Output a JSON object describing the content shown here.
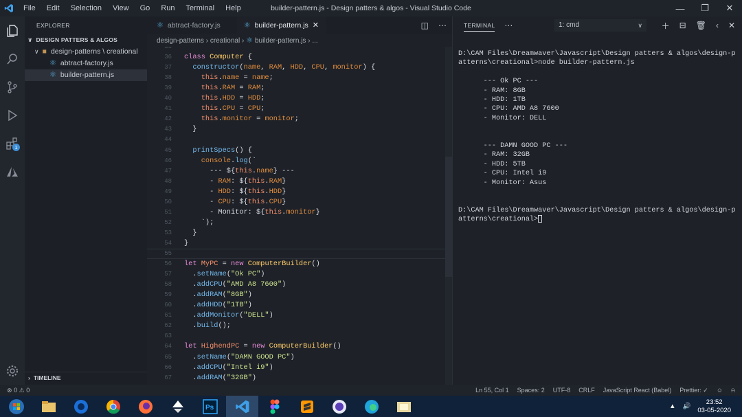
{
  "window": {
    "title": "builder-pattern.js - Design patters & algos - Visual Studio Code",
    "menu": [
      "File",
      "Edit",
      "Selection",
      "View",
      "Go",
      "Run",
      "Terminal",
      "Help"
    ],
    "controls": [
      "minimize",
      "maximize",
      "close"
    ]
  },
  "sidebar": {
    "header": "EXPLORER",
    "section": "DESIGN PATTERS & ALGOS",
    "folder": "design-patterns \\ creational",
    "files": [
      "abtract-factory.js",
      "builder-pattern.js"
    ],
    "timeline": "TIMELINE"
  },
  "activity": {
    "badge": "1"
  },
  "tabs": [
    {
      "label": "abtract-factory.js",
      "active": false
    },
    {
      "label": "builder-pattern.js",
      "active": true
    }
  ],
  "breadcrumb": {
    "parts": [
      "design-patterns",
      "creational",
      "builder-pattern.js",
      "..."
    ]
  },
  "code": {
    "first_line": 35,
    "lines": [
      "",
      "class Computer {",
      "  constructor(name, RAM, HDD, CPU, monitor) {",
      "    this.name = name;",
      "    this.RAM = RAM;",
      "    this.HDD = HDD;",
      "    this.CPU = CPU;",
      "    this.monitor = monitor;",
      "  }",
      "",
      "  printSpecs() {",
      "    console.log(`",
      "      --- ${this.name} ---",
      "      - RAM: ${this.RAM}",
      "      - HDD: ${this.HDD}",
      "      - CPU: ${this.CPU}",
      "      - Monitor: ${this.monitor}",
      "    `);",
      "  }",
      "}",
      "",
      "let MyPC = new ComputerBuilder()",
      "  .setName(\"Ok PC\")",
      "  .addCPU(\"AMD A8 7600\")",
      "  .addRAM(\"8GB\")",
      "  .addHDD(\"1TB\")",
      "  .addMonitor(\"DELL\")",
      "  .build();",
      "",
      "let HighendPC = new ComputerBuilder()",
      "  .setName(\"DAMN GOOD PC\")",
      "  .addCPU(\"Intel i9\")",
      "  .addRAM(\"32GB\")"
    ]
  },
  "panel": {
    "title": "TERMINAL",
    "shell": "1: cmd"
  },
  "terminal": {
    "lines": [
      "D:\\CAM Files\\Dreamwaver\\Javascript\\Design patters & algos\\design-p",
      "atterns\\creational>node builder-pattern.js",
      "",
      "      --- Ok PC ---",
      "      - RAM: 8GB",
      "      - HDD: 1TB",
      "      - CPU: AMD A8 7600",
      "      - Monitor: DELL",
      "",
      "",
      "      --- DAMN GOOD PC ---",
      "      - RAM: 32GB",
      "      - HDD: 5TB",
      "      - CPU: Intel i9",
      "      - Monitor: Asus",
      "",
      "",
      "D:\\CAM Files\\Dreamwaver\\Javascript\\Design patters & algos\\design-p"
    ],
    "prompt": "atterns\\creational>"
  },
  "status": {
    "problems": "0",
    "warnings": "0",
    "position": "Ln 55, Col 1",
    "spaces": "Spaces: 2",
    "encoding": "UTF-8",
    "eol": "CRLF",
    "language": "JavaScript React (Babel)",
    "prettier": "Prettier: ✓"
  },
  "taskbar": {
    "time": "23:52",
    "date": "03-05-2020"
  }
}
